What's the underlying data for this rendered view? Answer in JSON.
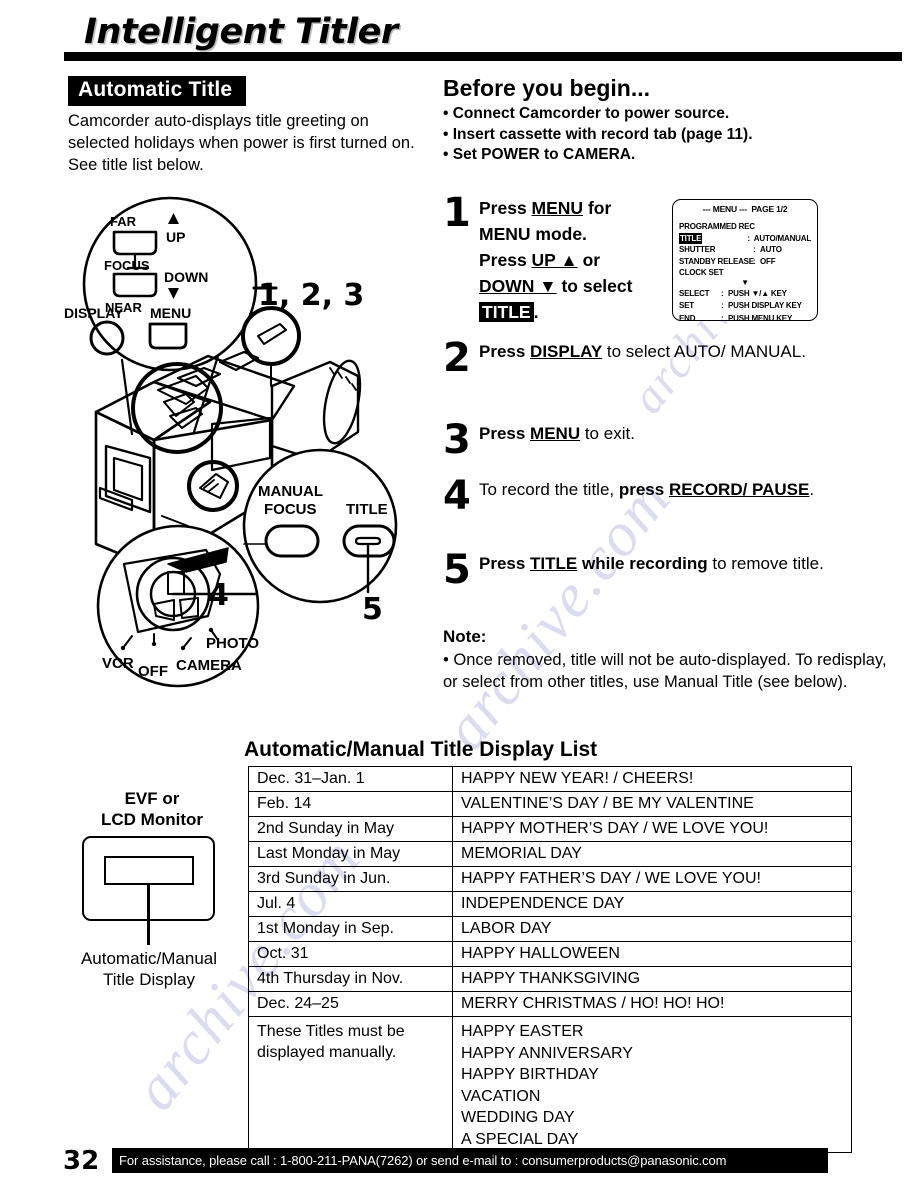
{
  "page": {
    "title": "Intelligent Titler",
    "number": "32",
    "footer_text": "For assistance, please call : 1-800-211-PANA(7262) or send e-mail to : consumerproducts@panasonic.com",
    "watermark": "archive.com"
  },
  "left_column": {
    "section_banner": "Automatic Title",
    "intro": "Camcorder auto-displays title greeting on selected holidays when power is first turned on. See title list below.",
    "callouts": {
      "steps_123": "1, 2, 3",
      "step_4": "4",
      "step_5": "5"
    },
    "camcorder_labels": {
      "far": "FAR",
      "up": "UP",
      "focus": "FOCUS",
      "down": "DOWN",
      "near": "NEAR",
      "display": "DISPLAY",
      "menu": "MENU",
      "manual_focus_line1": "MANUAL",
      "manual_focus_line2": "FOCUS",
      "title": "TITLE",
      "vcr": "VCR",
      "off": "OFF",
      "camera": "CAMERA",
      "photo": "PHOTO"
    }
  },
  "right_column": {
    "before_heading": "Before you begin...",
    "before_items": [
      "• Connect Camcorder to power source.",
      "• Insert cassette with record tab (page 11).",
      "• Set POWER to CAMERA."
    ],
    "steps": [
      {
        "num": "1",
        "text_parts": [
          "Press ",
          "MENU",
          " for MENU mode. Press ",
          "UP ▲",
          " or ",
          "DOWN ▼",
          " to select ",
          "TITLE",
          "."
        ]
      },
      {
        "num": "2"
      },
      {
        "num": "3"
      },
      {
        "num": "4"
      },
      {
        "num": "5"
      }
    ],
    "step1": {
      "l1_a": "Press ",
      "l1_b": "MENU",
      "l1_c": " for",
      "l2": "MENU mode.",
      "l3_a": "Press ",
      "l3_b": "UP ▲",
      "l3_c": " or",
      "l4_a": "DOWN ▼",
      "l4_b": " to select",
      "l5_a": "TITLE",
      "l5_b": "."
    },
    "step2": {
      "a": "Press ",
      "b": "DISPLAY",
      "c": " to select AUTO/ MANUAL."
    },
    "step3": {
      "a": "Press ",
      "b": "MENU",
      "c": " to exit."
    },
    "step4": {
      "a": "To record the title, ",
      "b": "press ",
      "c": "RECORD/ PAUSE",
      "d": "."
    },
    "step5": {
      "a": "Press ",
      "b": "TITLE",
      "c": " while recording",
      "d": " to remove title."
    },
    "note": {
      "heading": "Note:",
      "body": "• Once removed, title will not be auto-displayed. To redisplay, or select from other titles, use Manual Title (see below)."
    }
  },
  "menu_screen": {
    "header_left": "--- MENU ---",
    "header_right": "PAGE 1/2",
    "rows": [
      {
        "key": "PROGRAMMED REC",
        "sep": "",
        "value": "",
        "highlight": false
      },
      {
        "key": "TITLE",
        "sep": ":",
        "value": "AUTO/MANUAL",
        "highlight": true
      },
      {
        "key": "SHUTTER",
        "sep": ":",
        "value": "AUTO",
        "highlight": false
      },
      {
        "key": "STANDBY RELEASE",
        "sep": ":",
        "value": "OFF",
        "highlight": false
      },
      {
        "key": "CLOCK SET",
        "sep": "",
        "value": "",
        "highlight": false
      }
    ],
    "scroll_arrow": "▼",
    "footer_rows": [
      {
        "key": "SELECT",
        "sep": ":",
        "value": "PUSH ▼/▲ KEY"
      },
      {
        "key": "SET",
        "sep": ":",
        "value": "PUSH DISPLAY KEY"
      },
      {
        "key": "END",
        "sep": ":",
        "value": "PUSH MENU KEY"
      }
    ]
  },
  "evf_figure": {
    "caption_top_line1": "EVF or",
    "caption_top_line2": "LCD Monitor",
    "caption_bottom_line1": "Automatic/Manual",
    "caption_bottom_line2": "Title Display"
  },
  "table": {
    "heading": "Automatic/Manual Title Display List",
    "rows": [
      {
        "date": "Dec. 31–Jan. 1",
        "title": "HAPPY NEW YEAR! / CHEERS!"
      },
      {
        "date": "Feb. 14",
        "title": "VALENTINE’S DAY / BE MY VALENTINE"
      },
      {
        "date": "2nd Sunday in May",
        "title": "HAPPY MOTHER’S DAY / WE LOVE YOU!"
      },
      {
        "date": "Last Monday in May",
        "title": "MEMORIAL DAY"
      },
      {
        "date": "3rd Sunday in Jun.",
        "title": "HAPPY FATHER’S DAY / WE LOVE YOU!"
      },
      {
        "date": "Jul. 4",
        "title": "INDEPENDENCE DAY"
      },
      {
        "date": "1st Monday in Sep.",
        "title": "LABOR DAY"
      },
      {
        "date": "Oct. 31",
        "title": "HAPPY HALLOWEEN"
      },
      {
        "date": "4th Thursday in Nov.",
        "title": "HAPPY THANKSGIVING"
      },
      {
        "date": "Dec. 24–25",
        "title": "MERRY CHRISTMAS / HO! HO! HO!"
      }
    ],
    "manual_row": {
      "note_line1": "These Titles must be",
      "note_line2": "displayed manually.",
      "titles": [
        "HAPPY EASTER",
        "HAPPY ANNIVERSARY",
        "HAPPY BIRTHDAY",
        "VACATION",
        "WEDDING DAY",
        "A SPECIAL DAY"
      ]
    }
  }
}
